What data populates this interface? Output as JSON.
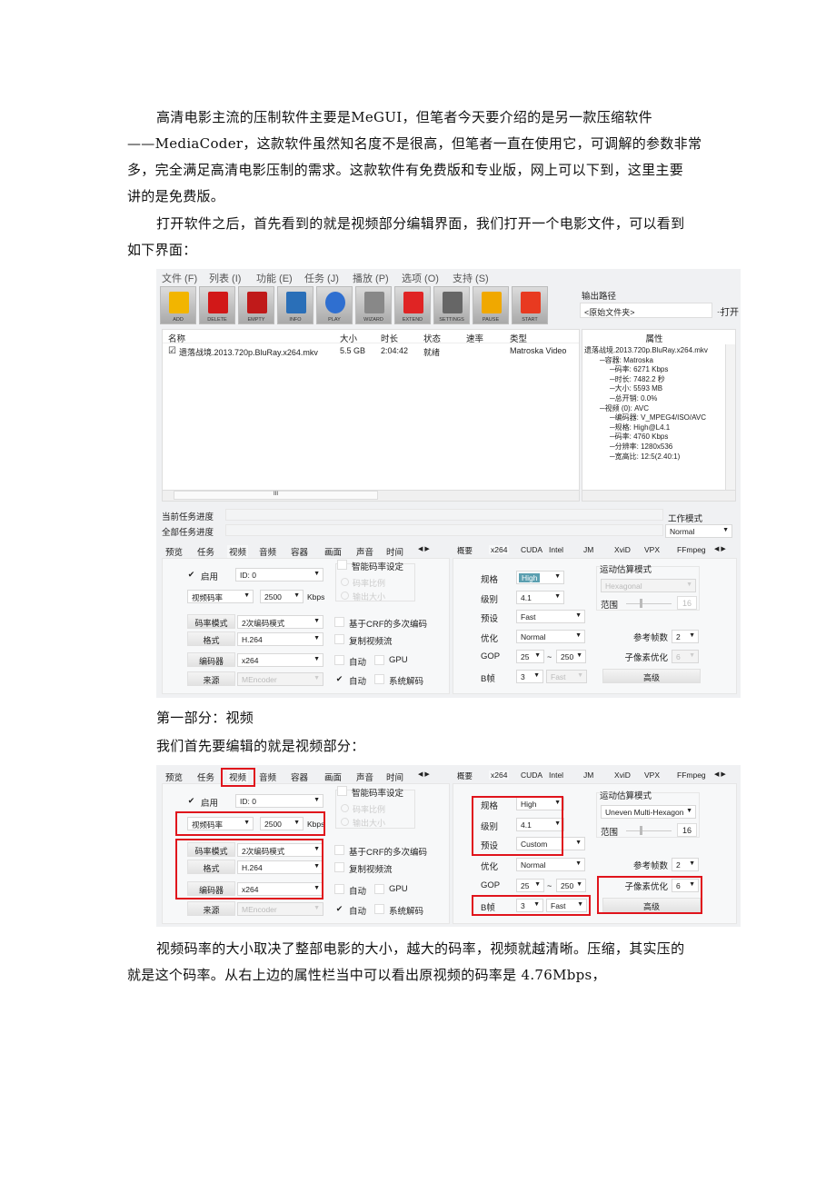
{
  "intro_lines": [
    "高清电影主流的压制软件主要是MeGUI，但笔者今天要介绍的是另一款压缩软件",
    "——MediaCoder，这款软件虽然知名度不是很高，但笔者一直在使用它，可调解的参数非常",
    "多，完全满足高清电影压制的需求。这款软件有免费版和专业版，网上可以下到，这里主要",
    "讲的是免费版。"
  ],
  "open_lines": [
    "打开软件之后，首先看到的就是视频部分编辑界面，我们打开一个电影文件，可以看到",
    "如下界面："
  ],
  "caption1": "第一部分：视频",
  "caption2": "我们首先要编辑的就是视频部分：",
  "outro_lines": [
    "视频码率的大小取决了整部电影的大小，越大的码率，视频就越清晰。压缩，其实压的",
    "就是这个码率。从右上边的属性栏当中可以看出原视频的码率是 4.76Mbps，"
  ],
  "app": {
    "menu": [
      "文件 (F)",
      "列表 (I)",
      "功能 (E)",
      "任务 (J)",
      "播放 (P)",
      "选项 (O)",
      "支持 (S)"
    ],
    "toolbar": [
      {
        "label": "ADD",
        "icon": "add-icon",
        "color": "#f2b500"
      },
      {
        "label": "DELETE",
        "icon": "delete-icon",
        "color": "#d21818"
      },
      {
        "label": "EMPTY",
        "icon": "empty-icon",
        "color": "#c01a1a"
      },
      {
        "label": "INFO",
        "icon": "info-icon",
        "color": "#2a6fb8"
      },
      {
        "label": "PLAY",
        "icon": "play-icon",
        "color": "#2f6fd0"
      },
      {
        "label": "WIZARD",
        "icon": "wizard-icon",
        "color": "#888"
      },
      {
        "label": "EXTEND",
        "icon": "puzzle-icon",
        "color": "#e02424"
      },
      {
        "label": "SETTINGS",
        "icon": "wrench-icon",
        "color": "#666"
      },
      {
        "label": "PAUSE",
        "icon": "pause-icon",
        "color": "#f0a800"
      },
      {
        "label": "START",
        "icon": "start-icon",
        "color": "#e83a20"
      }
    ],
    "output": {
      "label": "输出路径",
      "value": "<原始文件夹>",
      "browse": "...",
      "open": "打开"
    },
    "list": {
      "headers": [
        "名称",
        "大小",
        "时长",
        "状态",
        "速率",
        "类型"
      ],
      "rows": [
        {
          "checked": true,
          "name": "遗落战境.2013.720p.BluRay.x264.mkv",
          "size": "5.5 GB",
          "duration": "2:04:42",
          "status": "就绪",
          "rate": "",
          "type": "Matroska Video"
        }
      ],
      "hscroll_mark": "III"
    },
    "properties": {
      "header": "属性",
      "items": [
        {
          "level": 0,
          "text": "遗落战境.2013.720p.BluRay.x264.mkv"
        },
        {
          "level": 1,
          "text": "容器: Matroska"
        },
        {
          "level": 2,
          "text": "码率: 6271 Kbps"
        },
        {
          "level": 2,
          "text": "时长: 7482.2 秒"
        },
        {
          "level": 2,
          "text": "大小: 5593 MB"
        },
        {
          "level": 2,
          "text": "总开销: 0.0%"
        },
        {
          "level": 1,
          "text": "视频 (0): AVC"
        },
        {
          "level": 2,
          "text": "编码器: V_MPEG4/ISO/AVC"
        },
        {
          "level": 2,
          "text": "规格: High@L4.1"
        },
        {
          "level": 2,
          "text": "码率: 4760 Kbps"
        },
        {
          "level": 2,
          "text": "分辨率: 1280x536"
        },
        {
          "level": 2,
          "text": "宽高比: 12:5(2.40:1)"
        }
      ]
    },
    "progress": {
      "current": "当前任务进度",
      "all": "全部任务进度",
      "current_value": 0,
      "all_value": 0,
      "work_mode_label": "工作模式",
      "work_mode": "Normal"
    }
  },
  "panels": [
    {
      "left_tabs": [
        "预览",
        "任务",
        "视频",
        "音频",
        "容器",
        "画面",
        "声音",
        "时间"
      ],
      "left_active": 2,
      "right_tabs": [
        "概要",
        "x264",
        "CUDA",
        "Intel",
        "JM",
        "XviD",
        "VPX",
        "FFmpeg"
      ],
      "right_active": 1,
      "video": {
        "enable": "启用",
        "enable_checked": true,
        "track": "ID: 0",
        "bitrate_mode": "视频码率",
        "bitrate": "2500",
        "unit": "Kbps",
        "smart": "智能码率设定",
        "smart_opts": [
          "码率比例",
          "输出大小"
        ],
        "rc_btn": "码率模式",
        "rc": "2次编码模式",
        "fmt_btn": "格式",
        "fmt": "H.264",
        "enc_btn": "编码器",
        "enc": "x264",
        "src_btn": "来源",
        "src": "MEncoder",
        "crf": "基于CRF的多次编码",
        "copy": "复制视频流",
        "auto1": "自动",
        "gpu": "GPU",
        "auto2": "自动",
        "auto2_checked": true,
        "sysdec": "系统解码"
      },
      "x264": {
        "profile_label": "规格",
        "profile": "High",
        "profile_selected": true,
        "level_label": "级别",
        "level": "4.1",
        "preset_label": "预设",
        "preset": "Fast",
        "tune_label": "优化",
        "tune": "Normal",
        "gop_label": "GOP",
        "gop_min": "25",
        "gop_sep": "~",
        "gop_max": "250",
        "bframes_label": "B帧",
        "bframes": "3",
        "bmode": "Fast",
        "bmode_enabled": false,
        "me_label": "运动估算模式",
        "me": "Hexagonal",
        "me_enabled": false,
        "range_label": "范围",
        "range": "16",
        "ref_label": "参考帧数",
        "ref": "2",
        "subme_label": "子像素优化",
        "subme": "6",
        "subme_enabled": false,
        "advanced": "高级"
      }
    },
    {
      "left_tabs": [
        "预览",
        "任务",
        "视频",
        "音频",
        "容器",
        "画面",
        "声音",
        "时间"
      ],
      "left_active": 2,
      "right_tabs": [
        "概要",
        "x264",
        "CUDA",
        "Intel",
        "JM",
        "XviD",
        "VPX",
        "FFmpeg"
      ],
      "right_active": 1,
      "video": {
        "enable": "启用",
        "enable_checked": true,
        "track": "ID: 0",
        "bitrate_mode": "视频码率",
        "bitrate": "2500",
        "unit": "Kbps",
        "smart": "智能码率设定",
        "smart_opts": [
          "码率比例",
          "输出大小"
        ],
        "rc_btn": "码率模式",
        "rc": "2次编码模式",
        "fmt_btn": "格式",
        "fmt": "H.264",
        "enc_btn": "编码器",
        "enc": "x264",
        "src_btn": "来源",
        "src": "MEncoder",
        "crf": "基于CRF的多次编码",
        "copy": "复制视频流",
        "auto1": "自动",
        "gpu": "GPU",
        "auto2": "自动",
        "auto2_checked": true,
        "sysdec": "系统解码"
      },
      "x264": {
        "profile_label": "规格",
        "profile": "High",
        "profile_selected": false,
        "level_label": "级别",
        "level": "4.1",
        "preset_label": "预设",
        "preset": "Custom",
        "tune_label": "优化",
        "tune": "Normal",
        "gop_label": "GOP",
        "gop_min": "25",
        "gop_sep": "~",
        "gop_max": "250",
        "bframes_label": "B帧",
        "bframes": "3",
        "bmode": "Fast",
        "bmode_enabled": true,
        "me_label": "运动估算模式",
        "me": "Uneven Multi-Hexagon",
        "me_enabled": true,
        "range_label": "范围",
        "range": "16",
        "ref_label": "参考帧数",
        "ref": "2",
        "subme_label": "子像素优化",
        "subme": "6",
        "subme_enabled": true,
        "advanced": "高级"
      }
    }
  ],
  "colors": {
    "highlight_red": "#e0141c",
    "selection": "#5b9fb0"
  }
}
